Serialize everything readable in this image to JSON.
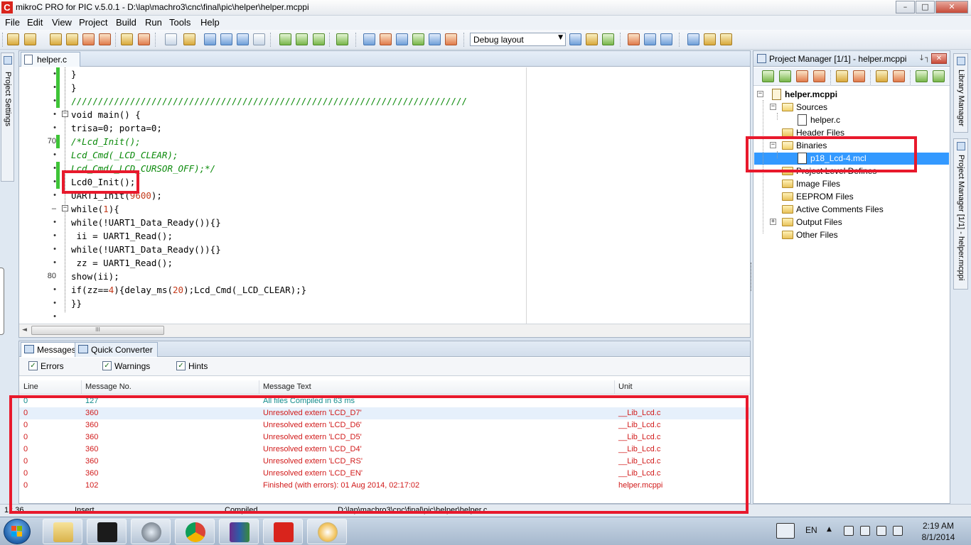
{
  "window": {
    "title": "mikroC PRO for PIC v.5.0.1 - D:\\lap\\machro3\\cnc\\final\\pic\\helper\\helper.mcppi",
    "app_icon_letter": "C",
    "min_label": "–",
    "max_label": "□",
    "close_label": "✕"
  },
  "menu": {
    "items": [
      "File",
      "Edit",
      "View",
      "Project",
      "Build",
      "Run",
      "Tools",
      "Help"
    ]
  },
  "toolbar": {
    "layout_value": "Debug layout",
    "layout_arrow": "▼"
  },
  "left_panel": {
    "tab_label": "Project Settings"
  },
  "editor": {
    "tab_label": "helper.c",
    "scroll_left_arrow": "◄",
    "scroll_thumb_grip": "III",
    "lines": [
      {
        "num": "•",
        "text": "}",
        "changed": true,
        "fold": "",
        "style": "plain"
      },
      {
        "num": "•",
        "text": "}",
        "changed": true,
        "fold": "",
        "style": "plain"
      },
      {
        "num": "•",
        "text": "//////////////////////////////////////////////////////////////////////////",
        "changed": true,
        "fold": "",
        "style": "slash"
      },
      {
        "num": "•",
        "text": "void main() {",
        "changed": false,
        "fold": "−",
        "style": "plain"
      },
      {
        "num": "•",
        "text": "trisa=0; porta=0;",
        "changed": false,
        "fold": "",
        "style": "plain"
      },
      {
        "num": "70",
        "text": "/*Lcd_Init();",
        "changed": true,
        "fold": "",
        "style": "comment"
      },
      {
        "num": "•",
        "text": "Lcd_Cmd(_LCD_CLEAR);",
        "changed": false,
        "fold": "",
        "style": "comment"
      },
      {
        "num": "•",
        "text": "Lcd_Cmd(_LCD_CURSOR_OFF);*/",
        "changed": true,
        "fold": "",
        "style": "comment"
      },
      {
        "num": "•",
        "text": "Lcd0_Init();",
        "changed": true,
        "fold": "",
        "style": "plain"
      },
      {
        "num": "•",
        "text": "UART1_Init(9600);",
        "changed": false,
        "fold": "",
        "style": "num",
        "pre": "UART1_Init(",
        "numv": "9600",
        "post": ");"
      },
      {
        "num": "–",
        "text": "while(1){",
        "changed": false,
        "fold": "−",
        "style": "num",
        "pre": "while(",
        "numv": "1",
        "post": "){"
      },
      {
        "num": "•",
        "text": "while(!UART1_Data_Ready()){}",
        "changed": false,
        "fold": "",
        "style": "plain"
      },
      {
        "num": "•",
        "text": " ii = UART1_Read();",
        "changed": false,
        "fold": "",
        "style": "plain"
      },
      {
        "num": "•",
        "text": "while(!UART1_Data_Ready()){}",
        "changed": false,
        "fold": "",
        "style": "plain"
      },
      {
        "num": "•",
        "text": " zz = UART1_Read();",
        "changed": false,
        "fold": "",
        "style": "plain"
      },
      {
        "num": "80",
        "text": "show(ii);",
        "changed": false,
        "fold": "",
        "style": "plain"
      },
      {
        "num": "•",
        "text": "if(zz==4){delay_ms(20);Lcd_Cmd(_LCD_CLEAR);}",
        "changed": false,
        "fold": "",
        "style": "if"
      },
      {
        "num": "•",
        "text": "}}",
        "changed": false,
        "fold": "",
        "style": "plain"
      },
      {
        "num": "•",
        "text": "",
        "changed": false,
        "fold": "",
        "style": "plain"
      }
    ]
  },
  "messages": {
    "tabs": [
      {
        "label": "Messages"
      },
      {
        "label": "Quick Converter"
      }
    ],
    "filters": [
      {
        "label": "Errors",
        "checked": true
      },
      {
        "label": "Warnings",
        "checked": true
      },
      {
        "label": "Hints",
        "checked": true
      }
    ],
    "check_mark": "✓",
    "columns": [
      "Line",
      "Message No.",
      "Message Text",
      "Unit"
    ],
    "rows": [
      {
        "line": "0",
        "no": "127",
        "text": "All files Compiled in 63 ms",
        "unit": "",
        "kind": "ok"
      },
      {
        "line": "0",
        "no": "360",
        "text": "Unresolved extern 'LCD_D7'",
        "unit": "__Lib_Lcd.c",
        "kind": "err"
      },
      {
        "line": "0",
        "no": "360",
        "text": "Unresolved extern 'LCD_D6'",
        "unit": "__Lib_Lcd.c",
        "kind": "err"
      },
      {
        "line": "0",
        "no": "360",
        "text": "Unresolved extern 'LCD_D5'",
        "unit": "__Lib_Lcd.c",
        "kind": "err"
      },
      {
        "line": "0",
        "no": "360",
        "text": "Unresolved extern 'LCD_D4'",
        "unit": "__Lib_Lcd.c",
        "kind": "err"
      },
      {
        "line": "0",
        "no": "360",
        "text": "Unresolved extern 'LCD_RS'",
        "unit": "__Lib_Lcd.c",
        "kind": "err"
      },
      {
        "line": "0",
        "no": "360",
        "text": "Unresolved extern 'LCD_EN'",
        "unit": "__Lib_Lcd.c",
        "kind": "err"
      },
      {
        "line": "0",
        "no": "102",
        "text": "Finished (with errors): 01 Aug 2014, 02:17:02",
        "unit": "helper.mcppi",
        "kind": "err"
      }
    ]
  },
  "statusbar": {
    "position": "1 : 36",
    "mode": "Insert",
    "state": "Compiled",
    "path": "D:\\lap\\machro3\\cnc\\final\\pic\\helper\\helper.c"
  },
  "project_manager": {
    "title": "Project Manager [1/1] - helper.mcppi",
    "pin": "↓┐",
    "close": "✕",
    "root": "helper.mcppi",
    "tree": [
      {
        "label": "Sources",
        "type": "folder-open",
        "expander": "−"
      },
      {
        "label": "helper.c",
        "type": "file",
        "expander": ""
      },
      {
        "label": "Header Files",
        "type": "folder",
        "expander": ""
      },
      {
        "label": "Binaries",
        "type": "folder-open",
        "expander": "−"
      },
      {
        "label": "p18_Lcd-4.mcl",
        "type": "file",
        "expander": "",
        "selected": true
      },
      {
        "label": "Project Level Defines",
        "type": "folder",
        "expander": ""
      },
      {
        "label": "Image Files",
        "type": "folder",
        "expander": ""
      },
      {
        "label": "EEPROM Files",
        "type": "folder",
        "expander": ""
      },
      {
        "label": "Active Comments Files",
        "type": "folder",
        "expander": ""
      },
      {
        "label": "Output Files",
        "type": "folder",
        "expander": "+"
      },
      {
        "label": "Other Files",
        "type": "folder",
        "expander": ""
      }
    ]
  },
  "right_panel": {
    "tabs": [
      {
        "label": "Library Manager"
      },
      {
        "label": "Project Manager [1/1] - helper.mcppi"
      }
    ]
  },
  "taskbar": {
    "apps": [
      "explorer",
      "e3-app",
      "magnifier",
      "chrome",
      "winrar",
      "mikroc",
      "paint"
    ],
    "lang": "EN",
    "tray_arrow": "▲",
    "time": "2:19 AM",
    "date": "8/1/2014"
  },
  "colors": {
    "error_text": "#d11a1a",
    "ok_text": "#128b8b",
    "annotation_red": "#e8192c",
    "selection_blue": "#3399ff",
    "change_bar_green": "#3ec437"
  }
}
